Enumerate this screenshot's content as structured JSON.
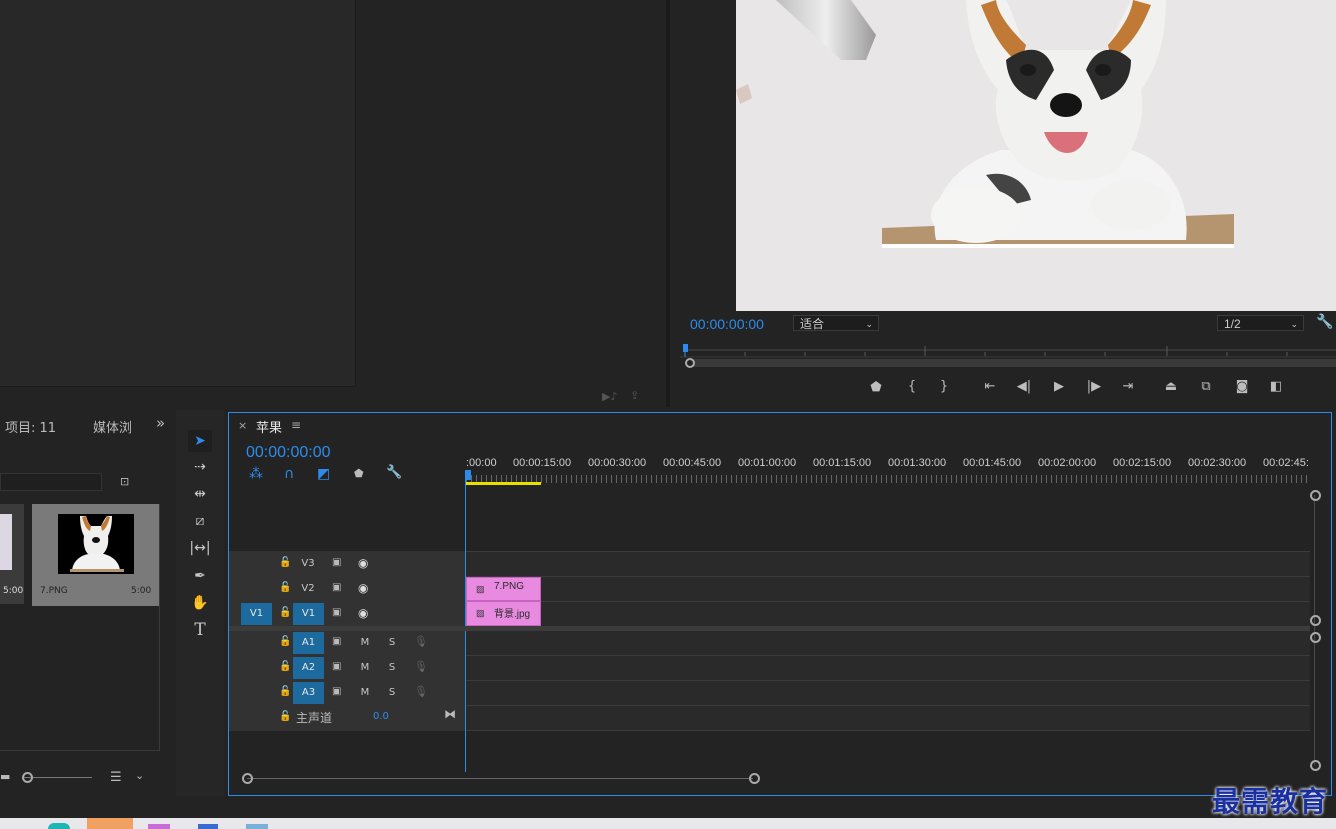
{
  "program": {
    "timecode": "00:00:00:00",
    "fit_label": "适合",
    "resolution_label": "1/2"
  },
  "project": {
    "tab_project": "项目: 11",
    "tab_media": "媒体浏",
    "more": "»",
    "item1_duration": "5:00",
    "item2_name": "7.PNG",
    "item2_duration": "5:00"
  },
  "timeline": {
    "close": "×",
    "sequence_name": "苹果",
    "menu": "≡",
    "timecode": "00:00:00:00",
    "ruler": [
      ":00:00",
      "00:00:15:00",
      "00:00:30:00",
      "00:00:45:00",
      "00:01:00:00",
      "00:01:15:00",
      "00:01:30:00",
      "00:01:45:00",
      "00:02:00:00",
      "00:02:15:00",
      "00:02:30:00",
      "00:02:45:"
    ],
    "tracks": {
      "v3": "V3",
      "v2": "V2",
      "v1": "V1",
      "v1_source": "V1",
      "a1": "A1",
      "a2": "A2",
      "a3": "A3",
      "m": "M",
      "s": "S",
      "master_label": "主声道",
      "master_value": "0.0"
    },
    "clips": {
      "v2_clip": "7.PNG",
      "v1_clip": "背景.jpg"
    }
  },
  "watermark": "最需教育",
  "colors": {
    "accent_blue": "#2d8ceb",
    "clip_pink": "#e88ae0",
    "track_selected": "#1d6a9e"
  }
}
